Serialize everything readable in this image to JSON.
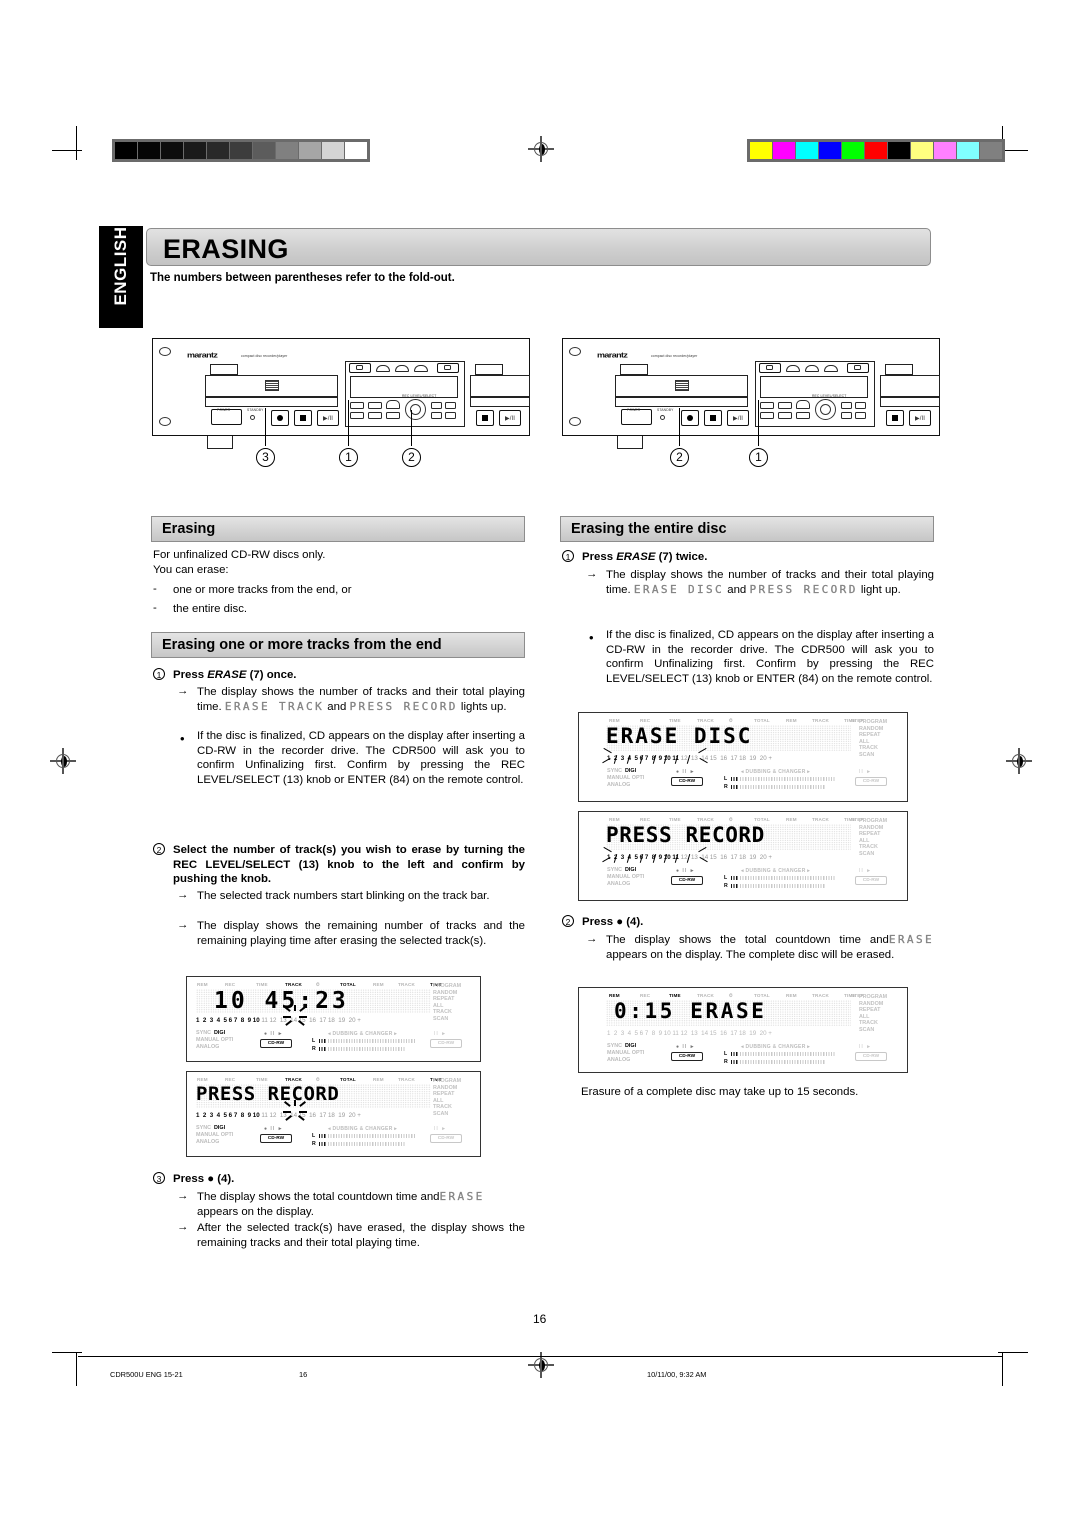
{
  "document": {
    "page_number": "16",
    "language_tab": "ENGLISH",
    "title": "ERASING",
    "subnote": "The numbers between parentheses refer to the fold-out."
  },
  "footer": {
    "left": "CDR500U ENG 15-21",
    "page": "16",
    "timestamp": "10/11/00, 9:32 AM"
  },
  "colorbars": {
    "gray": [
      "#000000",
      "#050505",
      "#0d0d0d",
      "#1a1a1a",
      "#292929",
      "#3d3d3d",
      "#5c5c5c",
      "#808080",
      "#a6a6a6",
      "#d4d4d4",
      "#ffffff"
    ],
    "color": [
      "#ffff00",
      "#ff00ff",
      "#00ffff",
      "#0000ff",
      "#00ff00",
      "#ff0000",
      "#000000",
      "#ffff80",
      "#ff80ff",
      "#80ffff",
      "#808080"
    ]
  },
  "devices": {
    "left": {
      "brand": "marantz",
      "model_tag": "compact disc recorder/player",
      "callouts": [
        "3",
        "1",
        "2"
      ]
    },
    "right": {
      "brand": "marantz",
      "model_tag": "compact disc recorder/player",
      "callouts": [
        "2",
        "1"
      ]
    }
  },
  "left_column": {
    "section1": {
      "heading": "Erasing",
      "lines": [
        "For unfinalized CD-RW discs only.",
        "You can erase:"
      ],
      "bullets": [
        "one or more tracks from the end, or",
        "the entire disc."
      ]
    },
    "section2": {
      "heading": "Erasing one or more tracks from the end",
      "step1": {
        "marker": "1",
        "title_pre": "Press ",
        "title_em": "ERASE",
        "title_post": " (7) once.",
        "arrow1_a": "The display shows the number of tracks and their total playing time.",
        "arrow1_lcd1": "ERASE TRACK",
        "arrow1_mid": "and",
        "arrow1_lcd2": "PRESS RECORD",
        "arrow1_b": "lights up.",
        "bullet": "If the disc is finalized, CD appears on the display after inserting a CD-RW in the recorder drive. The CDR500 will ask you to confirm Unfinalizing first. Confirm by pressing the REC LEVEL/SELECT (13) knob or ENTER (84) on the remote control."
      },
      "step2": {
        "marker": "2",
        "title": "Select the number of track(s) you wish to erase by turning the REC LEVEL/SELECT (13) knob to the left and confirm by pushing the knob.",
        "arrow1": "The selected track numbers start blinking on the track bar.",
        "arrow2": "The display shows the remaining number of tracks and the remaining playing time after erasing the selected track(s)."
      },
      "step3": {
        "marker": "3",
        "title_pre": "Press ",
        "title_symbol": "●",
        "title_post": " (4).",
        "arrow1_a": "The display shows the total countdown time and",
        "arrow1_lcd": "ERASE",
        "arrow1_b": "appears on the display.",
        "arrow2": "After the selected track(s) have erased, the display shows the remaining tracks and their total playing time."
      }
    }
  },
  "right_column": {
    "section1": {
      "heading": "Erasing the entire disc",
      "step1": {
        "marker": "1",
        "title_pre": "Press ",
        "title_em": "ERASE",
        "title_post": " (7) twice.",
        "arrow1_a": "The display shows the number of tracks and their total playing time.",
        "arrow1_lcd1": "ERASE DISC",
        "arrow1_mid": "and",
        "arrow1_lcd2": "PRESS RECORD",
        "arrow1_b": "light up.",
        "bullet": "If the disc is finalized, CD appears on the display after inserting a CD-RW in the recorder drive. The CDR500 will ask you to confirm Unfinalizing first. Confirm by pressing the REC LEVEL/SELECT (13) knob or ENTER (84) on the remote control."
      },
      "step2": {
        "marker": "2",
        "title_pre": "Press ",
        "title_symbol": "●",
        "title_post": " (4).",
        "arrow1_a": "The display shows the total countdown time and",
        "arrow1_lcd": "ERASE",
        "arrow1_b": "appears on the display. The complete disc will be erased."
      },
      "closing": "Erasure of a complete disc may take up to 15 seconds."
    }
  },
  "lcd_displays": [
    {
      "id": "left-display-1",
      "segment_text": "10  45:23",
      "top_labels_on": [
        "TRACK",
        "TOTAL",
        "TIME"
      ],
      "top_labels": [
        "REM",
        "REC",
        "TIME",
        "TRACK",
        "▰▰▰",
        "TOTAL",
        "REM",
        "TRACK",
        "TIME",
        "",
        "",
        "",
        "",
        "STEP"
      ],
      "track_numbers": "1 2 3 4 5 6 7 8 9 10 11 12 13 14 15 16 17 18 19 20 +",
      "blinking_track": "10",
      "right_labels": [
        "PROGRAM",
        "RANDOM",
        "REPEAT",
        "ALL",
        "TRACK",
        "SCAN"
      ],
      "source_labels": [
        "SYNC",
        "DIGI",
        "MANUAL",
        "OPTI",
        "ANALOG"
      ],
      "source_active": "DIGI",
      "dubbing_label": "DUBBING & CHANGER",
      "disc_label": "CD-RW",
      "meters": [
        "L",
        "R"
      ]
    },
    {
      "id": "left-display-2",
      "segment_text": "PRESS RECORD",
      "top_labels_on": [
        "TRACK",
        "TOTAL",
        "TIME"
      ],
      "track_numbers": "1 2 3 4 5 6 7 8 9 10 11 12 13 14 15 16 17 18 19 20 +",
      "blinking_track": "10",
      "right_labels": [
        "PROGRAM",
        "RANDOM",
        "REPEAT",
        "ALL",
        "TRACK",
        "SCAN"
      ],
      "source_active": "DIGI",
      "disc_label": "CD-RW"
    },
    {
      "id": "right-display-1",
      "segment_text": "ERASE DISC",
      "top_labels_on": [],
      "track_numbers": "1 2 3 4 5 6 7 8 9 10 11 12 13 14 15 16 17 18 19 20 +",
      "blinking_track": "all",
      "right_labels": [
        "PROGRAM",
        "RANDOM",
        "REPEAT",
        "ALL",
        "TRACK",
        "SCAN"
      ],
      "source_active": "DIGI",
      "disc_label": "CD-RW"
    },
    {
      "id": "right-display-2",
      "segment_text": "PRESS RECORD",
      "top_labels_on": [],
      "track_numbers": "1 2 3 4 5 6 7 8 9 10 11 12 13 14 15 16 17 18 19 20 +",
      "blinking_track": "all",
      "right_labels": [
        "PROGRAM",
        "RANDOM",
        "REPEAT",
        "ALL",
        "TRACK",
        "SCAN"
      ],
      "source_active": "DIGI",
      "disc_label": "CD-RW"
    },
    {
      "id": "right-display-3",
      "segment_text": "0:15 ERASE",
      "top_labels_on": [
        "REM",
        "TIME"
      ],
      "track_numbers": "1 2 3 4 5 6 7 8 9 10 11 12 13 14 15 16 17 18 19 20 +",
      "blinking_track": "",
      "right_labels": [
        "PROGRAM",
        "RANDOM",
        "REPEAT",
        "ALL",
        "TRACK",
        "SCAN"
      ],
      "source_active": "DIGI",
      "disc_label": "CD-RW"
    }
  ]
}
